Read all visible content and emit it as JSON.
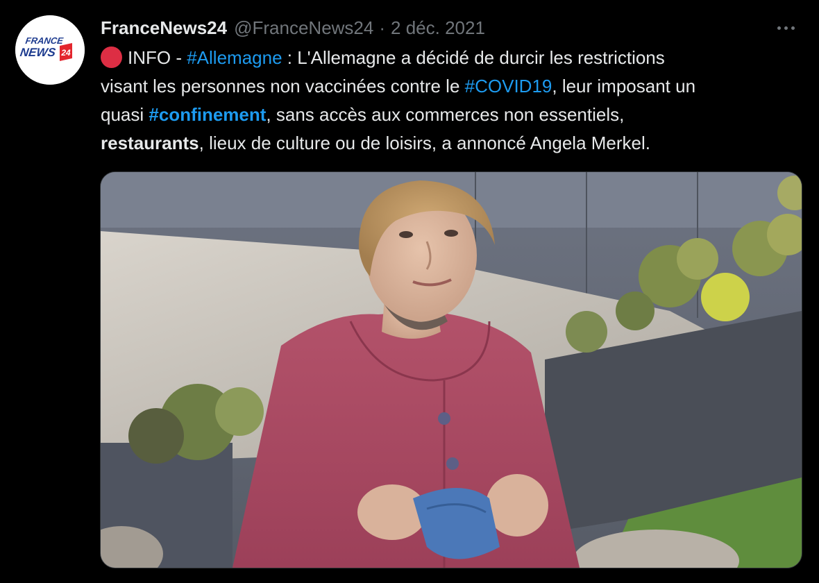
{
  "tweet": {
    "author": {
      "display_name": "FranceNews24",
      "handle": "@FranceNews24",
      "avatar_logo_text": [
        "FRANCE",
        "NEWS",
        "24"
      ]
    },
    "separator": "·",
    "date": "2 déc. 2021",
    "more_icon": "more-horizontal-icon",
    "text": {
      "emoji": "red-circle-icon",
      "l1_a": "INFO - ",
      "l1_hashtag": "#Allemagne",
      "l1_b": " : L'Allemagne a décidé de durcir les restrictions",
      "l2_a": "visant les personnes non vaccinées contre le ",
      "l2_hashtag": "#COVID19",
      "l2_b": ", leur imposant un",
      "l3_a": "quasi ",
      "l3_hashtag": "#confinement",
      "l3_b": ", sans accès aux commerces non essentiels,",
      "l4_bold": "restaurants",
      "l4_b": ", lieux de culture ou de loisirs, a annoncé Angela Merkel."
    },
    "media": {
      "kind": "photo"
    }
  },
  "colors": {
    "background": "#000000",
    "text": "#e7e9ea",
    "muted": "#71767b",
    "link": "#1d9bf0",
    "emoji_red": "#dd2e44",
    "logo_red": "#e3262e",
    "logo_navy": "#1d3b8f"
  }
}
